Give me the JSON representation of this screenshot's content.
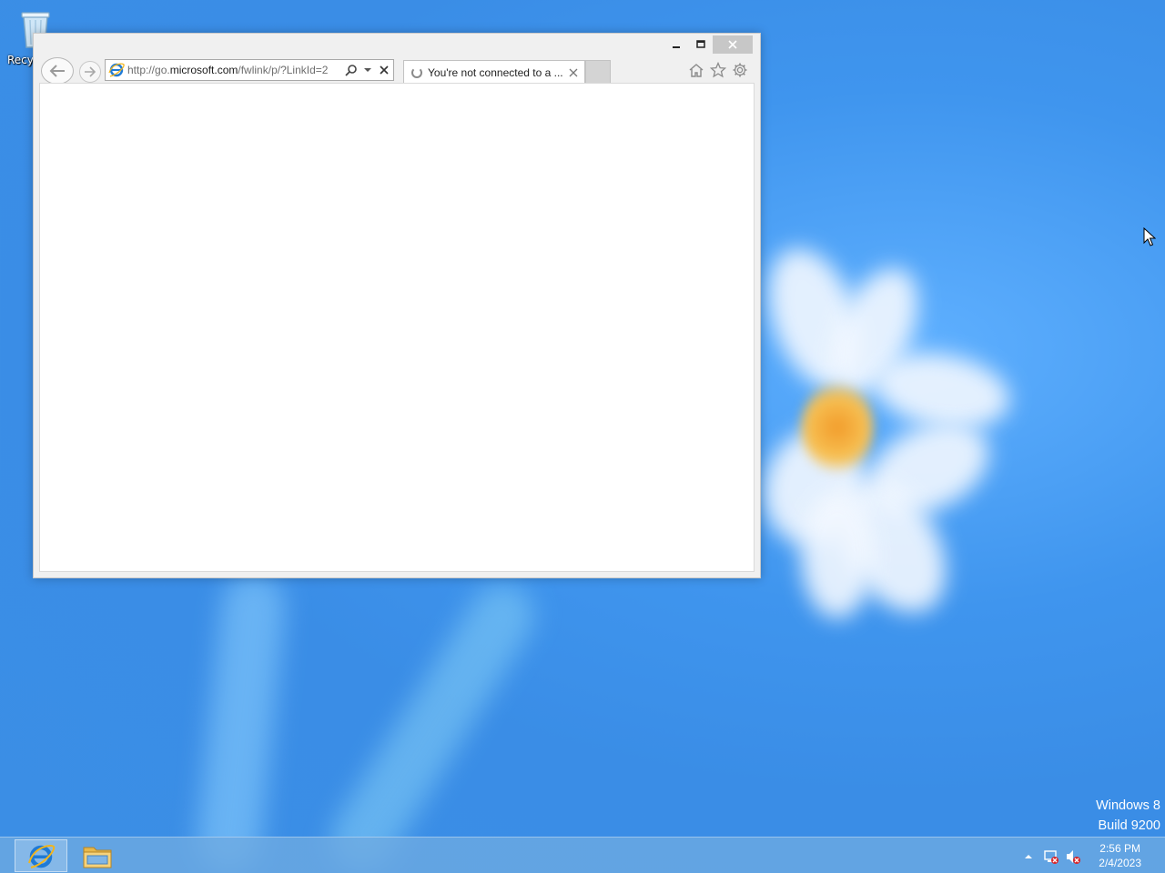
{
  "desktop": {
    "recycle_bin_label": "Recycle Bin",
    "watermark_line1": "Windows 8",
    "watermark_line2": "Build 9200"
  },
  "browser": {
    "address_url_prefix": "http://go.",
    "address_url_host": "microsoft.com",
    "address_url_suffix": "/fwlink/p/?LinkId=2",
    "tab_title": "You're not connected to a ...",
    "icons": {
      "back": "back-arrow-icon",
      "forward": "forward-arrow-icon",
      "search": "search-icon",
      "dropdown": "chevron-down-icon",
      "stop": "close-icon",
      "home": "home-icon",
      "favorites": "star-icon",
      "tools": "gear-icon"
    }
  },
  "taskbar": {
    "pinned": [
      "internet-explorer-icon",
      "file-explorer-icon"
    ],
    "clock_time": "2:56 PM",
    "clock_date": "2/4/2023"
  },
  "colors": {
    "desktop_blue": "#3b8ee5",
    "close_button": "#c7c7c7",
    "ie_blue": "#1f7ad6"
  }
}
